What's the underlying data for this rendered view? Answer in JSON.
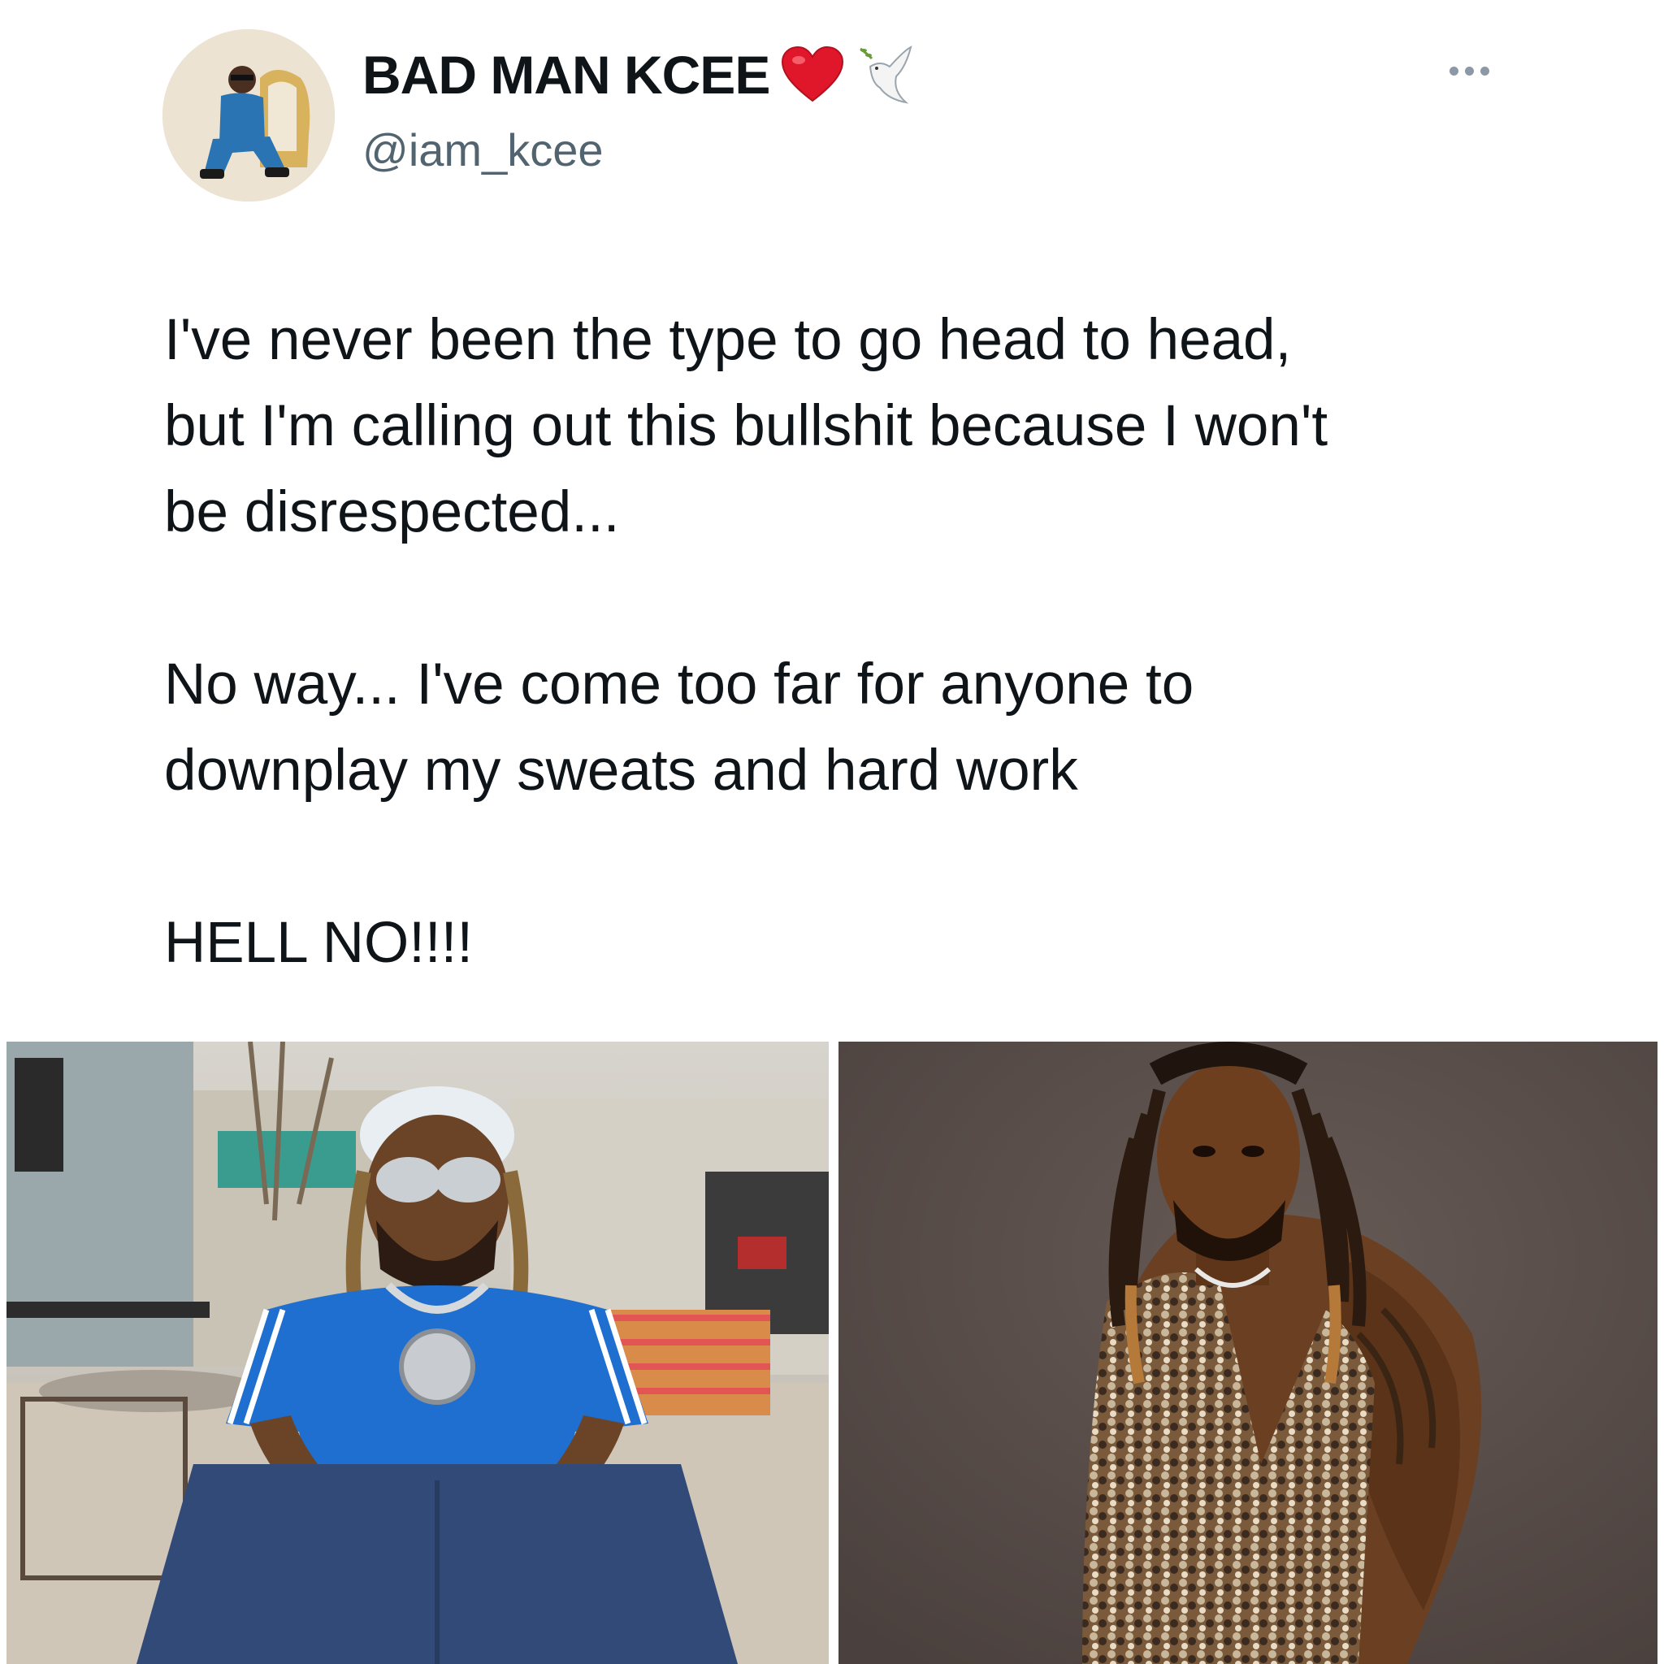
{
  "tweet": {
    "author": {
      "display_name": "BAD MAN KCEE",
      "name_emojis": [
        "heart-icon",
        "dove-icon"
      ],
      "handle": "@iam_kcee"
    },
    "text_paragraphs": [
      "I've never been the type to go head to head,\nbut I'm calling out this bullshit because I won't\nbe disrespected...",
      "No way... I've come too far for anyone to\ndownplay my sweats and hard work",
      "HELL NO!!!!"
    ],
    "media": [
      {
        "alt_icon": "photo-man-blue-shirt"
      },
      {
        "alt_icon": "photo-man-sequin-vest"
      }
    ]
  },
  "colors": {
    "text": "#0f1419",
    "secondary": "#536471",
    "heart": "#e0172b"
  }
}
